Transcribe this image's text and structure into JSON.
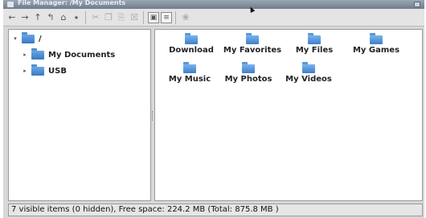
{
  "window": {
    "title": "File Manager: /My Documents"
  },
  "toolbar": {
    "back_icon": "arrow-left-icon",
    "forward_icon": "arrow-right-icon",
    "up_icon": "arrow-up-icon",
    "parent_icon": "go-home-icon",
    "home_icon": "home-icon",
    "new_folder_icon": "new-folder-icon",
    "cut_icon": "cut-icon",
    "copy_icon": "copy-icon",
    "paste_icon": "paste-icon",
    "delete_icon": "trash-icon",
    "view_icons_icon": "view-icons-icon",
    "view_list_icon": "view-list-icon",
    "hint_icon": "lightbulb-icon"
  },
  "tree": {
    "root": {
      "label": "/"
    },
    "items": [
      {
        "label": "My Documents"
      },
      {
        "label": "USB"
      }
    ]
  },
  "files": {
    "items": [
      {
        "label": "Download"
      },
      {
        "label": "My Favorites"
      },
      {
        "label": "My Files"
      },
      {
        "label": "My Games"
      },
      {
        "label": "My Music"
      },
      {
        "label": "My Photos"
      },
      {
        "label": "My Videos"
      }
    ]
  },
  "status": {
    "text": "7 visible items (0 hidden), Free space: 224.2 MB (Total: 875.8 MB )"
  },
  "colors": {
    "folder": "#4a88d2",
    "titlebar": "#7e8c9c"
  }
}
